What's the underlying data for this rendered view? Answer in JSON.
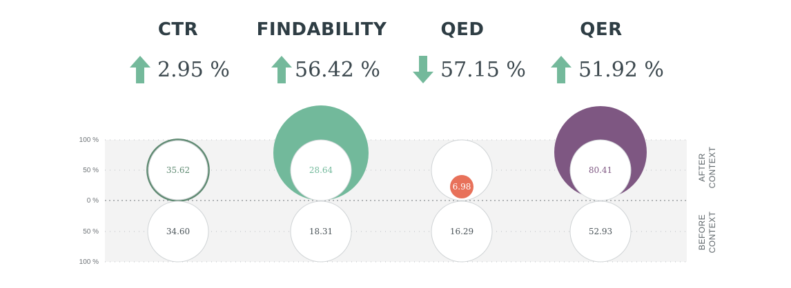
{
  "colors": {
    "up": "#74b99b",
    "down": "#74b99b",
    "accent_findability": "#72b99b",
    "accent_qer": "#7e5782",
    "accent_qed": "#e8715a",
    "accent_ctr": "#5f8a72",
    "text_dark": "#2e3d44",
    "grid_band": "#f3f3f3"
  },
  "metrics": [
    {
      "title": "CTR",
      "direction": "up",
      "change": "2.95 %",
      "arrow_icon": "arrow-up-icon"
    },
    {
      "title": "FINDABILITY",
      "direction": "up",
      "change": "56.42 %",
      "arrow_icon": "arrow-up-icon"
    },
    {
      "title": "QED",
      "direction": "down",
      "change": "57.15 %",
      "arrow_icon": "arrow-down-icon"
    },
    {
      "title": "QER",
      "direction": "up",
      "change": "51.92 %",
      "arrow_icon": "arrow-up-icon"
    }
  ],
  "chart_data": {
    "type": "bubble-comparison",
    "categories": [
      "CTR",
      "FINDABILITY",
      "QED",
      "QER"
    ],
    "series": [
      {
        "name": "AFTER CONTEXT",
        "values": [
          35.62,
          28.64,
          6.98,
          80.41
        ]
      },
      {
        "name": "BEFORE CONTEXT",
        "values": [
          34.6,
          18.31,
          16.29,
          52.93
        ]
      }
    ],
    "value_labels": {
      "after": [
        "35.62",
        "28.64",
        "6.98",
        "80.41"
      ],
      "before": [
        "34.60",
        "18.31",
        "16.29",
        "52.93"
      ]
    },
    "y_ticks_after": [
      "100 %",
      "50 %",
      "0 %"
    ],
    "y_ticks_before": [
      "50 %",
      "100 %"
    ],
    "ylim": [
      0,
      100
    ],
    "side_labels": {
      "after": [
        "AFTER",
        "CONTEXT"
      ],
      "before": [
        "BEFORE",
        "CONTEXT"
      ]
    },
    "grid": true
  }
}
